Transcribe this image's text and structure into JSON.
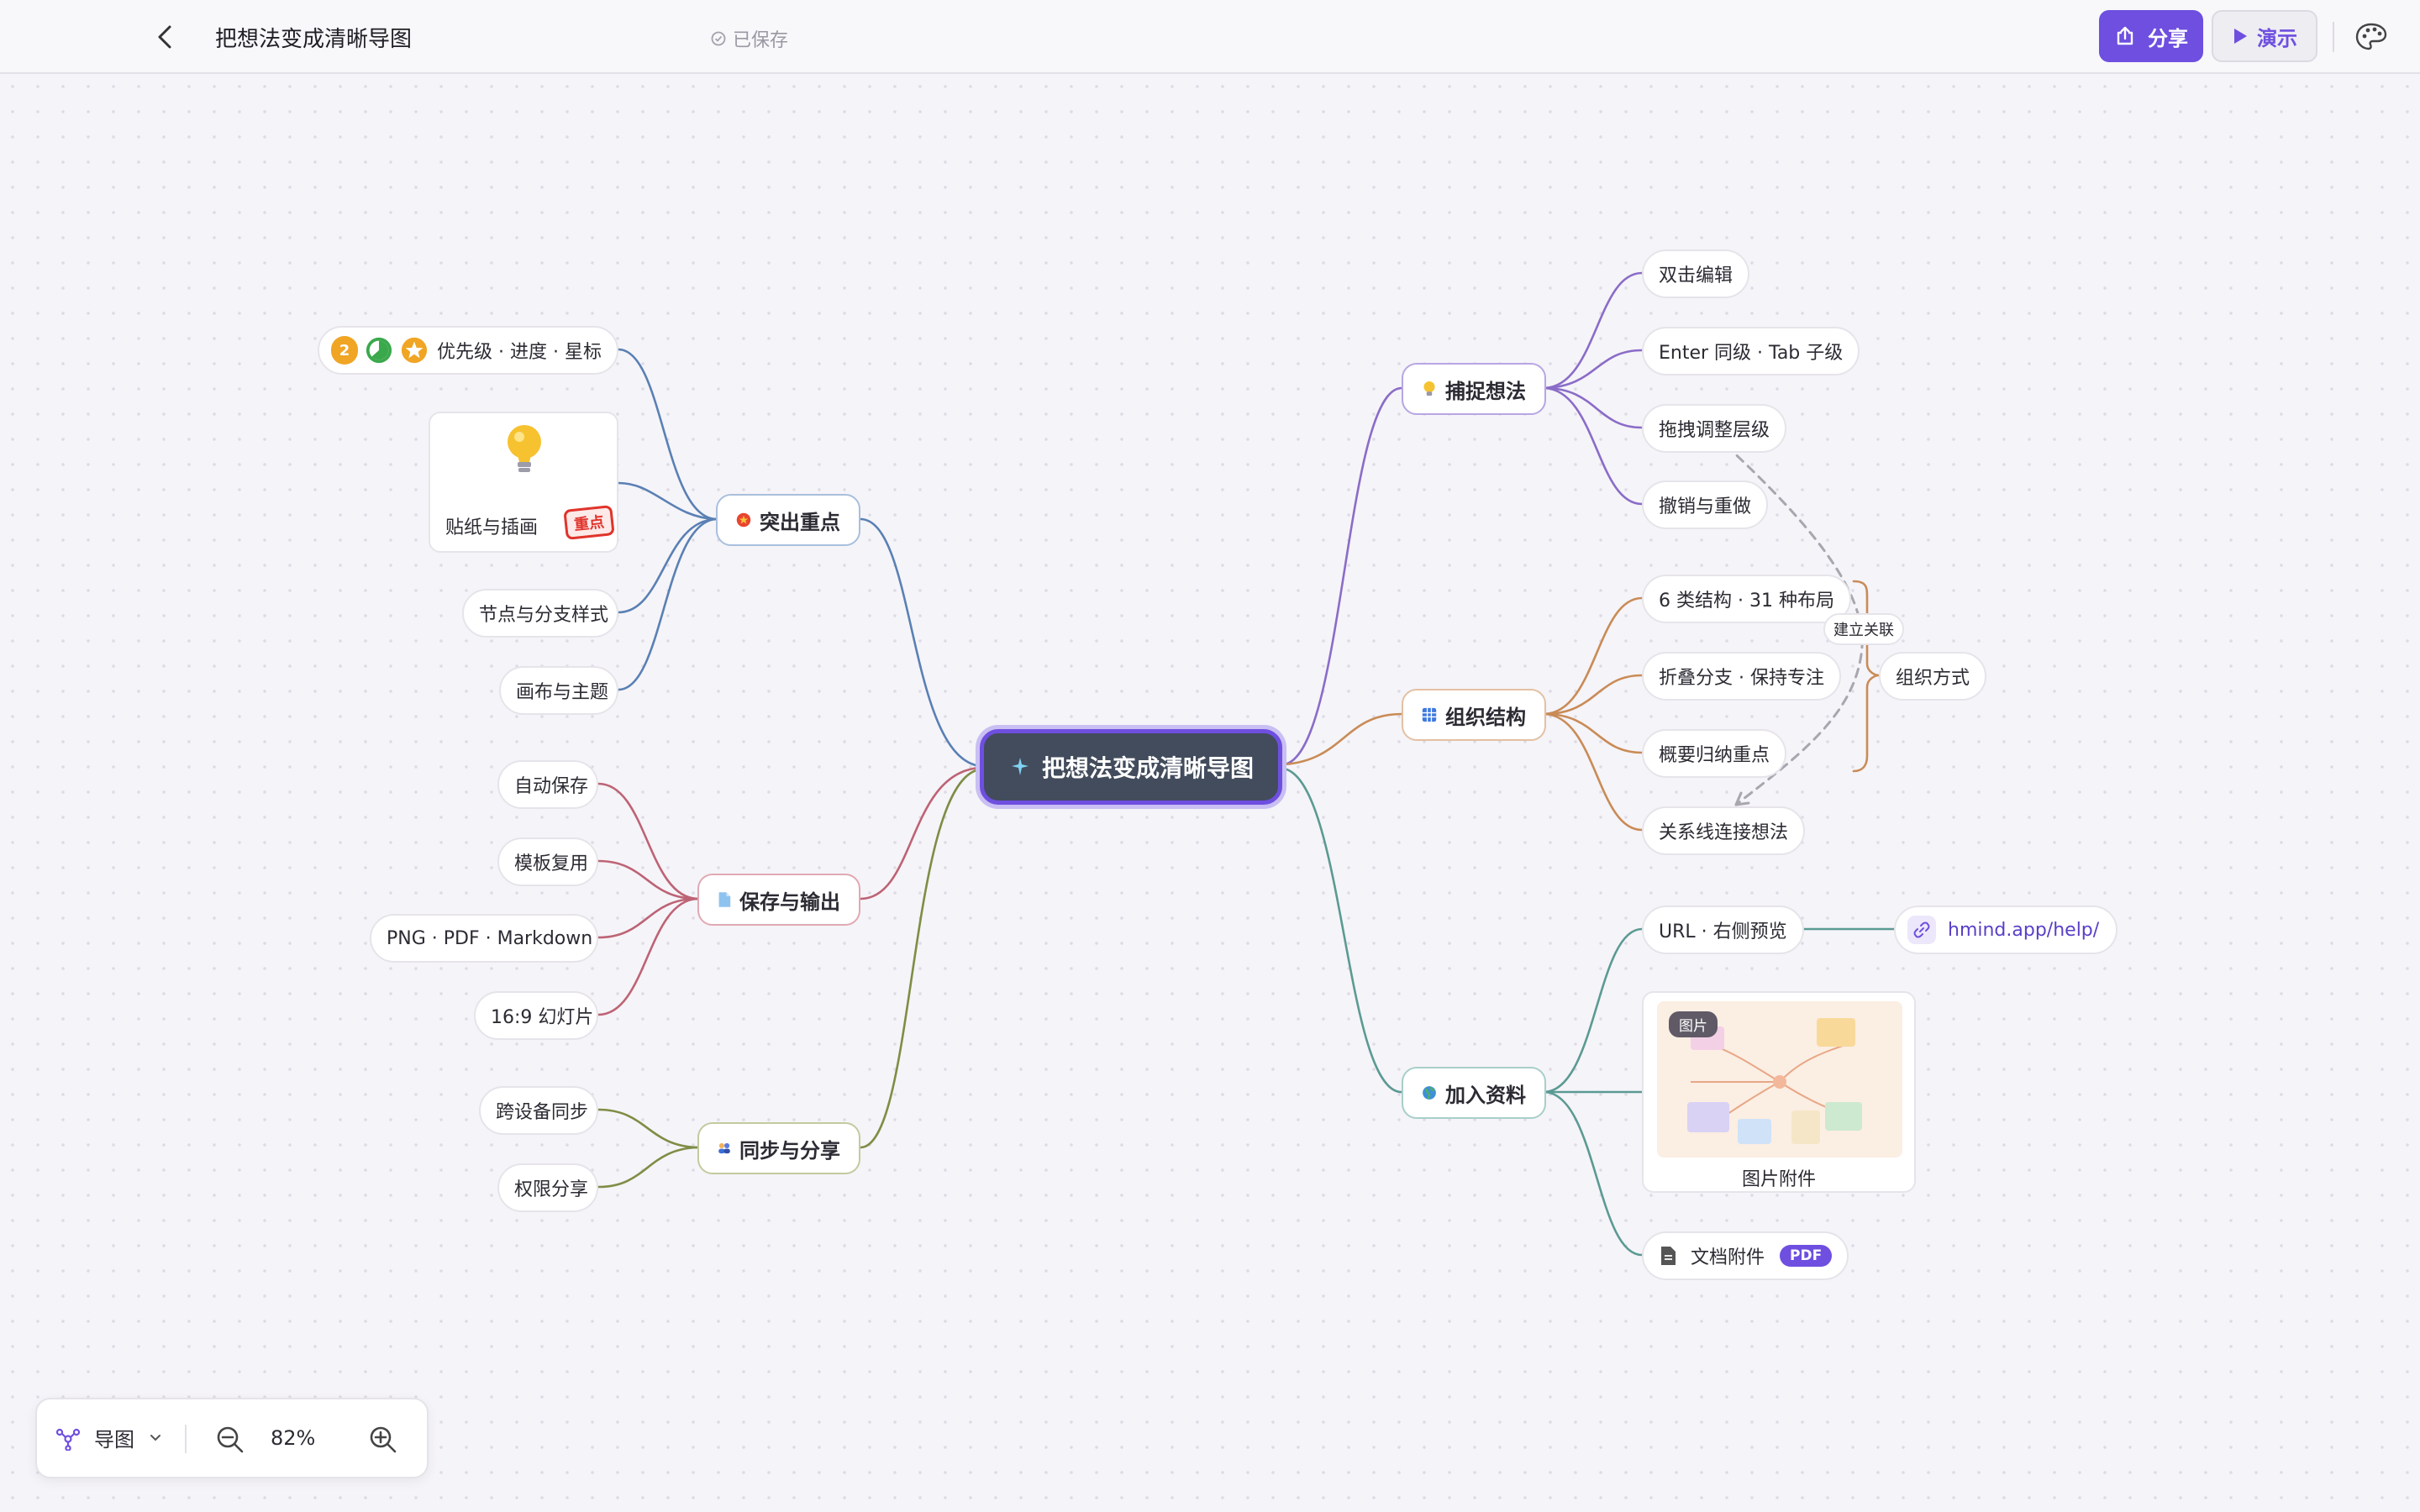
{
  "header": {
    "title": "把想法变成清晰导图",
    "saved_status": "已保存",
    "share_label": "分享",
    "present_label": "演示"
  },
  "central": {
    "label": "把想法变成清晰导图",
    "icon": "sparkle-icon"
  },
  "branches": {
    "capture": {
      "label": "捕捉想法",
      "icon": "lightbulb-icon",
      "color": "#8a6cc8",
      "children": [
        "双击编辑",
        "Enter 同级 · Tab 子级",
        "拖拽调整层级",
        "撤销与重做"
      ]
    },
    "structure": {
      "label": "组织结构",
      "icon": "grid-icon",
      "color": "#c98b57",
      "children": [
        "6 类结构 · 31 种布局",
        "折叠分支 · 保持专注",
        "概要归纳重点",
        "关系线连接想法"
      ],
      "summary_label": "组织方式",
      "relation_label": "建立关联"
    },
    "resources": {
      "label": "加入资料",
      "icon": "globe-icon",
      "color": "#5b9a93",
      "url_label": "URL · 右侧预览",
      "link_text": "hmind.app/help/",
      "image_caption": "图片附件",
      "image_badge": "图片",
      "doc_label": "文档附件",
      "doc_tag": "PDF"
    },
    "highlight": {
      "label": "突出重点",
      "icon": "star-badge-icon",
      "color": "#5a80b4",
      "markers_label": "优先级 · 进度 · 星标",
      "priority_number": "2",
      "sticker_label": "贴纸与插画",
      "sticker_stamp": "重点",
      "children": [
        "节点与分支样式",
        "画布与主题"
      ]
    },
    "export": {
      "label": "保存与输出",
      "icon": "document-icon",
      "color": "#bd6375",
      "children": [
        "自动保存",
        "模板复用",
        "PNG · PDF · Markdown",
        "16:9 幻灯片"
      ]
    },
    "sync": {
      "label": "同步与分享",
      "icon": "users-icon",
      "color": "#7e8d45",
      "children": [
        "跨设备同步",
        "权限分享"
      ]
    }
  },
  "bottom_bar": {
    "mode_label": "导图",
    "zoom_level": "82%"
  }
}
